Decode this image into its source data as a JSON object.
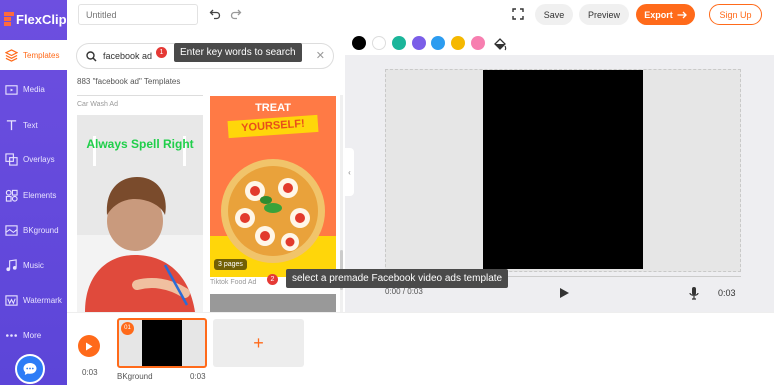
{
  "app": {
    "name": "FlexClip"
  },
  "nav": {
    "items": [
      {
        "label": "Templates",
        "icon": "layers-icon",
        "active": true
      },
      {
        "label": "Media",
        "icon": "folder-icon"
      },
      {
        "label": "Text",
        "icon": "text-icon"
      },
      {
        "label": "Overlays",
        "icon": "overlays-icon"
      },
      {
        "label": "Elements",
        "icon": "elements-icon"
      },
      {
        "label": "BKground",
        "icon": "background-icon"
      },
      {
        "label": "Music",
        "icon": "music-icon"
      },
      {
        "label": "Watermark",
        "icon": "watermark-icon"
      },
      {
        "label": "More",
        "icon": "more-icon"
      }
    ]
  },
  "toolbar": {
    "title_placeholder": "Untitled",
    "save_label": "Save",
    "preview_label": "Preview",
    "export_label": "Export",
    "signup_label": "Sign Up"
  },
  "search": {
    "value": "facebook ad",
    "results_label": "883 \"facebook ad\" Templates"
  },
  "templates": {
    "items": [
      {
        "category": "Car Wash Ad",
        "headline": "Always Spell Right"
      },
      {
        "category": "Tiktok Food Ad",
        "headline_top": "TREAT",
        "headline_bottom": "YOURSELF!",
        "pages": "3 pages"
      }
    ]
  },
  "tooltips": {
    "step1": {
      "num": "1",
      "text": "Enter key words to search"
    },
    "step2": {
      "num": "2",
      "text": "select a premade Facebook video ads template"
    }
  },
  "colors": {
    "swatches": [
      "#000000",
      "#ffffff",
      "#1bb59a",
      "#7b5ee8",
      "#2c9cf0",
      "#f5b800",
      "#f77fb0"
    ],
    "accent": "#ff6a1a",
    "nav_bg": "#5c45d8"
  },
  "player": {
    "current": "0:00 / 0:03",
    "total": "0:03"
  },
  "timeline": {
    "time": "0:03",
    "scene": {
      "num": "01",
      "label": "BKground",
      "duration": "0:03"
    },
    "add_symbol": "+"
  }
}
